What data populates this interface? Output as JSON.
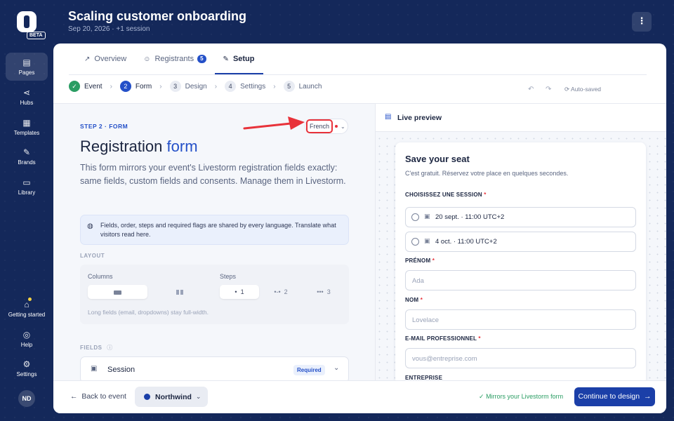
{
  "nav": {
    "items": [
      {
        "label": "Pages",
        "icon": "pages-icon"
      },
      {
        "label": "Hubs",
        "icon": "share-icon"
      },
      {
        "label": "Templates",
        "icon": "grid-icon"
      },
      {
        "label": "Brands",
        "icon": "brush-icon"
      },
      {
        "label": "Library",
        "icon": "tv-icon"
      }
    ],
    "bottom": [
      {
        "label": "Getting started",
        "icon": "graduation-cap-icon"
      },
      {
        "label": "Help",
        "icon": "lifebuoy-icon"
      },
      {
        "label": "Settings",
        "icon": "gear-icon"
      }
    ],
    "beta": "BETA",
    "avatar": "ND"
  },
  "header": {
    "title": "Scaling customer onboarding",
    "subtitle": "Sep 20, 2026 · +1 session"
  },
  "tabs": [
    {
      "label": "Overview",
      "icon": "trend-icon"
    },
    {
      "label": "Registrants",
      "icon": "users-icon",
      "count": "5"
    },
    {
      "label": "Setup",
      "icon": "edit-icon"
    }
  ],
  "steps": [
    {
      "num": "✓",
      "label": "Event",
      "state": "done"
    },
    {
      "num": "2",
      "label": "Form",
      "state": "current"
    },
    {
      "num": "3",
      "label": "Design",
      "state": "todo"
    },
    {
      "num": "4",
      "label": "Settings",
      "state": "todo"
    },
    {
      "num": "5",
      "label": "Launch",
      "state": "todo"
    }
  ],
  "autosave": "Auto-saved",
  "editor": {
    "step_label": "STEP 2 · FORM",
    "language": "French",
    "title_main": "Registration",
    "title_accent": "form",
    "description": "This form mirrors your event's Livestorm registration fields exactly: same fields, custom fields and consents. Manage them in Livestorm.",
    "info": "Fields, order, steps and required flags are shared by every language. Translate what visitors read here.",
    "layout_label": "LAYOUT",
    "columns_label": "Columns",
    "steps_label": "Steps",
    "steps_options": [
      "1",
      "2",
      "3"
    ],
    "layout_hint": "Long fields (email, dropdowns) stay full-width.",
    "fields_label": "FIELDS",
    "field": {
      "name": "Session",
      "badge": "Required"
    }
  },
  "footer": {
    "back": "Back to event",
    "brand": "Northwind",
    "mirrors": "Mirrors your Livestorm form",
    "continue": "Continue to design"
  },
  "preview": {
    "header": "Live preview",
    "title": "Save your seat",
    "subtitle": "C'est gratuit. Réservez votre place en quelques secondes.",
    "session_label": "CHOISISSEZ UNE SESSION",
    "sessions": [
      "20 sept. · 11:00 UTC+2",
      "4 oct. · 11:00 UTC+2"
    ],
    "firstname_label": "PRÉNOM",
    "firstname_ph": "Ada",
    "lastname_label": "NOM",
    "lastname_ph": "Lovelace",
    "email_label": "E-MAIL PROFESSIONNEL",
    "email_ph": "vous@entreprise.com",
    "company_label": "ENTREPRISE",
    "required_mark": "*"
  },
  "colors": {
    "background": "#14285a",
    "accent": "#2450c8",
    "primary_button": "#1b3fa8",
    "success": "#2a9d63",
    "highlight": "#e8323a"
  }
}
